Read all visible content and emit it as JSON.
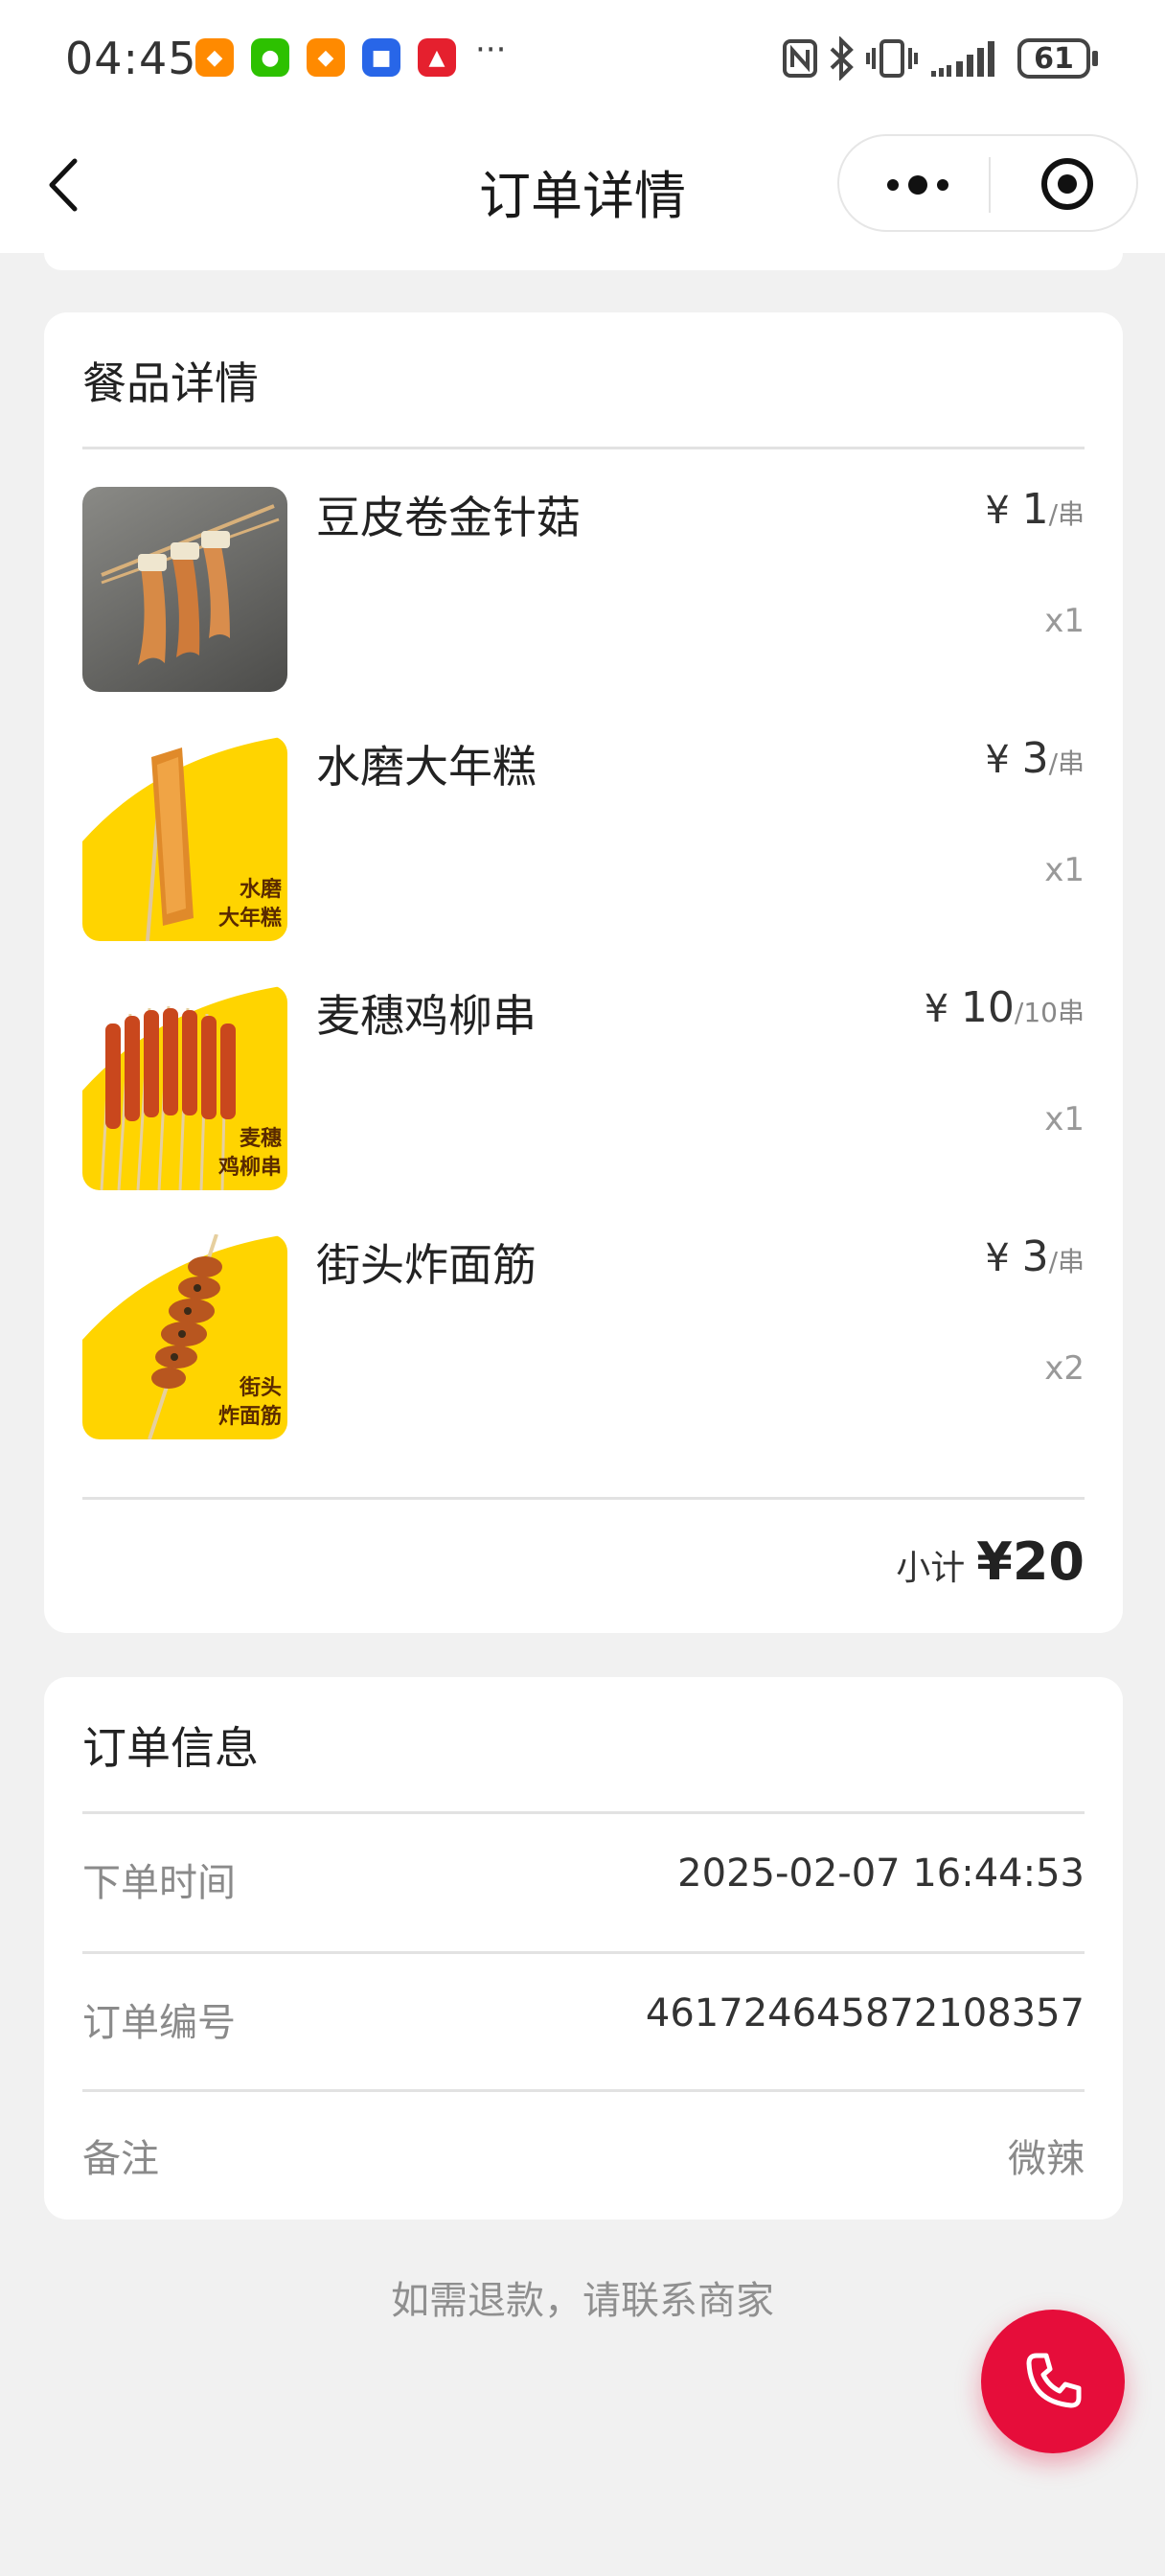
{
  "status_bar": {
    "time": "04:45",
    "app_icons": [
      "taobao-icon",
      "wechat-icon",
      "taobao-icon",
      "security-app-icon",
      "alipay-app-icon"
    ],
    "more": "···",
    "battery": "61"
  },
  "nav": {
    "title": "订单详情"
  },
  "food_card": {
    "title": "餐品详情",
    "items": [
      {
        "name": "豆皮卷金针菇",
        "yen": "¥ ",
        "price": "1",
        "unit": "/串",
        "qty": "x1"
      },
      {
        "name": "水磨大年糕",
        "yen": "¥ ",
        "price": "3",
        "unit": "/串",
        "qty": "x1",
        "img_text": [
          "水磨",
          "大年糕"
        ]
      },
      {
        "name": "麦穗鸡柳串",
        "yen": "¥ ",
        "price": "10",
        "unit": "/10串",
        "qty": "x1",
        "img_text": [
          "麦穗",
          "鸡柳串"
        ]
      },
      {
        "name": "街头炸面筋",
        "yen": "¥ ",
        "price": "3",
        "unit": "/串",
        "qty": "x2",
        "img_text": [
          "街头",
          "炸面筋"
        ]
      }
    ],
    "subtotal_label": "小计",
    "subtotal_value": "¥20"
  },
  "order_info": {
    "title": "订单信息",
    "rows": [
      {
        "label": "下单时间",
        "value": "2025-02-07 16:44:53"
      },
      {
        "label": "订单编号",
        "value": "461724645872108357"
      },
      {
        "label": "备注",
        "value": "微辣"
      }
    ]
  },
  "refund_tip": "如需退款，请联系商家",
  "colors": {
    "accent": "#e60d3a",
    "background": "#f1f1f1",
    "card": "#ffffff",
    "poster_yellow": "#ffd400"
  }
}
